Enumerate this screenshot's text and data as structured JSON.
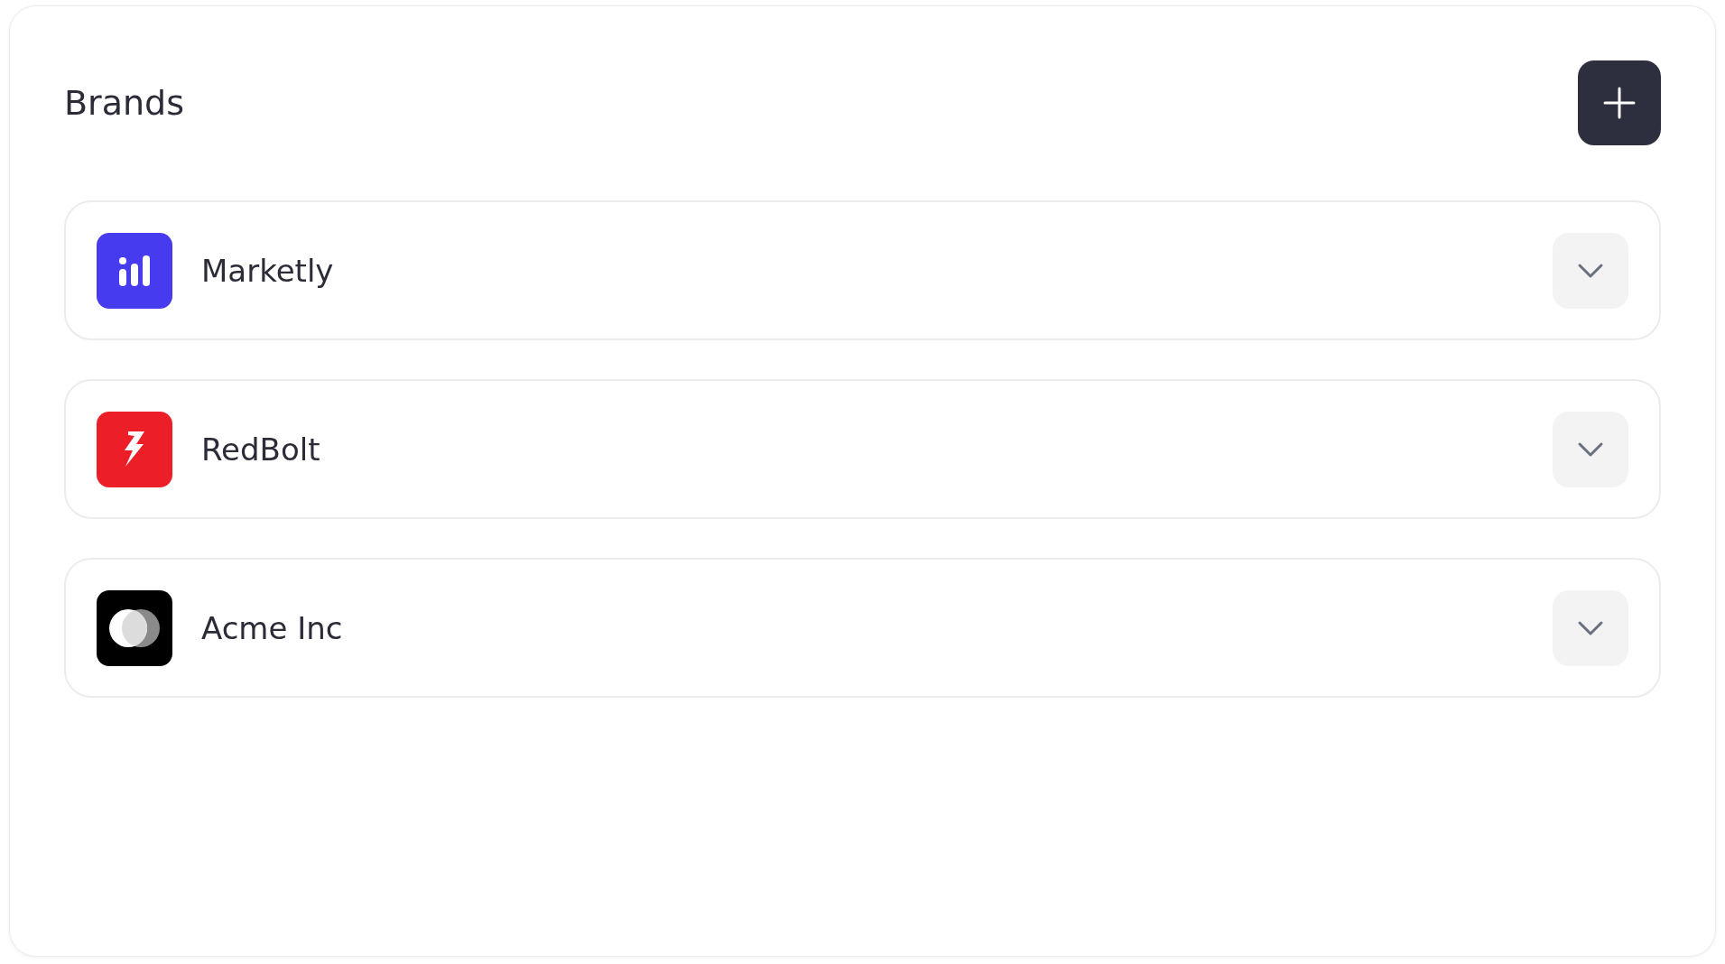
{
  "header": {
    "title": "Brands"
  },
  "brands": [
    {
      "name": "Marketly",
      "kind": "bars",
      "color": "#473bf0",
      "expanded": false
    },
    {
      "name": "RedBolt",
      "kind": "bolt",
      "color": "#ec1f29",
      "expanded": false
    },
    {
      "name": "Acme Inc",
      "kind": "circles",
      "color": "#000000",
      "expanded": false
    }
  ]
}
